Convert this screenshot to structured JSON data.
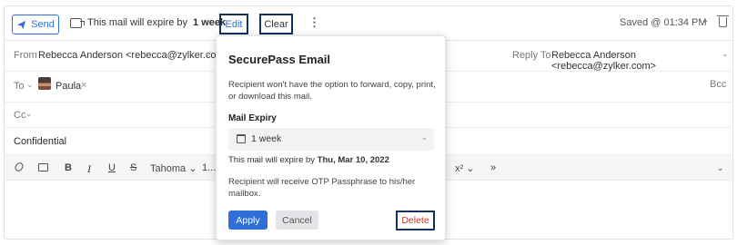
{
  "toolbar": {
    "send_label": "Send",
    "expire_prefix": "This mail will expire by",
    "expire_value": "1 week",
    "edit_label": "Edit",
    "clear_label": "Clear",
    "more_label": "⋮",
    "saved_text": "Saved @ 01:34 PM",
    "saved_chevron": "⌄"
  },
  "from": {
    "label": "From",
    "value": "Rebecca Anderson <rebecca@zylker.com>",
    "chevron": "⌄",
    "reply_to_label": "Reply To",
    "reply_to_value": "Rebecca Anderson <rebecca@zylker.com>"
  },
  "to": {
    "label": "To",
    "chevron": "⌄",
    "recipient": "Paula",
    "remove": "×",
    "bcc_label": "Bcc"
  },
  "cc": {
    "label": "Cc",
    "chevron": "⌄"
  },
  "subject": "Confidential",
  "format_bar": {
    "bold": "B",
    "italic": "I",
    "underline": "U",
    "strike": "S",
    "font": "Tahoma ⌄",
    "size": "1...",
    "superscript": "x² ⌄",
    "more": "»",
    "end_chevron": "⌄"
  },
  "popover": {
    "title": "SecurePass Email",
    "description": "Recipient won't have the option to forward, copy, print, or download this mail.",
    "expiry_heading": "Mail Expiry",
    "expiry_option": "1 week",
    "expiry_chevron": "⌄",
    "expire_date_prefix": "This mail will expire by",
    "expire_date_value": "Thu, Mar 10, 2022",
    "otp_note": "Recipient will receive OTP Passphrase to his/her mailbox.",
    "apply_label": "Apply",
    "cancel_label": "Cancel",
    "delete_label": "Delete"
  },
  "colors": {
    "accent": "#2f6fd7",
    "highlight_border": "#14305f",
    "danger": "#c8322b"
  }
}
